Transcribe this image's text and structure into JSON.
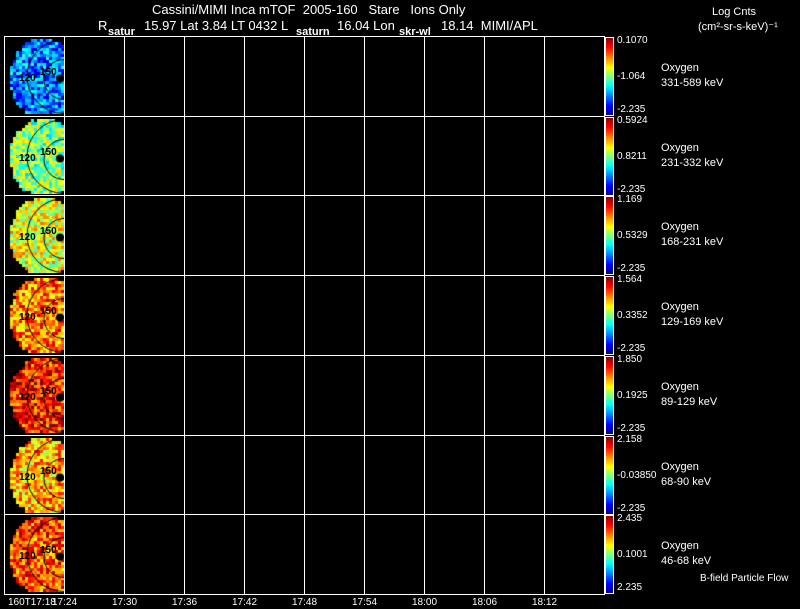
{
  "header": {
    "title": "Cassini/MIMI Inca mTOF  2005-160   Stare   Ions Only",
    "ephemeris": {
      "r_label": "R",
      "r_value": "15.97",
      "lat_label": "Lat",
      "lat_value": "3.84",
      "lt_label": "LT",
      "lt_value": "0432",
      "l_label": "L",
      "l_value": "16.04",
      "lon_label": "Lon",
      "lon_value": "18.14",
      "credit": "MIMI/APL"
    },
    "markers": [
      "satur",
      "saturn",
      "skr-wl"
    ],
    "units_title": "Log Cnts",
    "units": "(cm²-sr-s-keV)⁻¹"
  },
  "chart_data": {
    "type": "heatmap",
    "xlabel": "",
    "x_ticks": [
      "160T17:18",
      "17:24",
      "17:30",
      "17:36",
      "17:42",
      "17:48",
      "17:54",
      "18:00",
      "18:06",
      "18:12"
    ],
    "panel_labels": [
      "120",
      "150"
    ],
    "footer_note": "B-field Particle Flow",
    "colormap": "jet",
    "panels": [
      {
        "species": "Oxygen",
        "energy": "331-589 keV",
        "max": "0.1070",
        "mid": "-1.064",
        "min": "-2.235",
        "level": 0.25
      },
      {
        "species": "Oxygen",
        "energy": "231-332 keV",
        "max": "0.5924",
        "mid": "0.8211",
        "min": "-2.235",
        "level": 0.5
      },
      {
        "species": "Oxygen",
        "energy": "168-231 keV",
        "max": "1.169",
        "mid": "0.5329",
        "min": "-2.235",
        "level": 0.6
      },
      {
        "species": "Oxygen",
        "energy": "129-169 keV",
        "max": "1.564",
        "mid": "0.3352",
        "min": "-2.235",
        "level": 0.75
      },
      {
        "species": "Oxygen",
        "energy": "89-129 keV",
        "max": "1.850",
        "mid": "0.1925",
        "min": "-2.235",
        "level": 0.85
      },
      {
        "species": "Oxygen",
        "energy": "68-90 keV",
        "max": "2.158",
        "mid": "-0.03850",
        "min": "-2.235",
        "level": 0.7
      },
      {
        "species": "Oxygen",
        "energy": "46-68 keV",
        "max": "2.435",
        "mid": "0.1001",
        "min": "2.235",
        "level": 0.8
      }
    ]
  }
}
